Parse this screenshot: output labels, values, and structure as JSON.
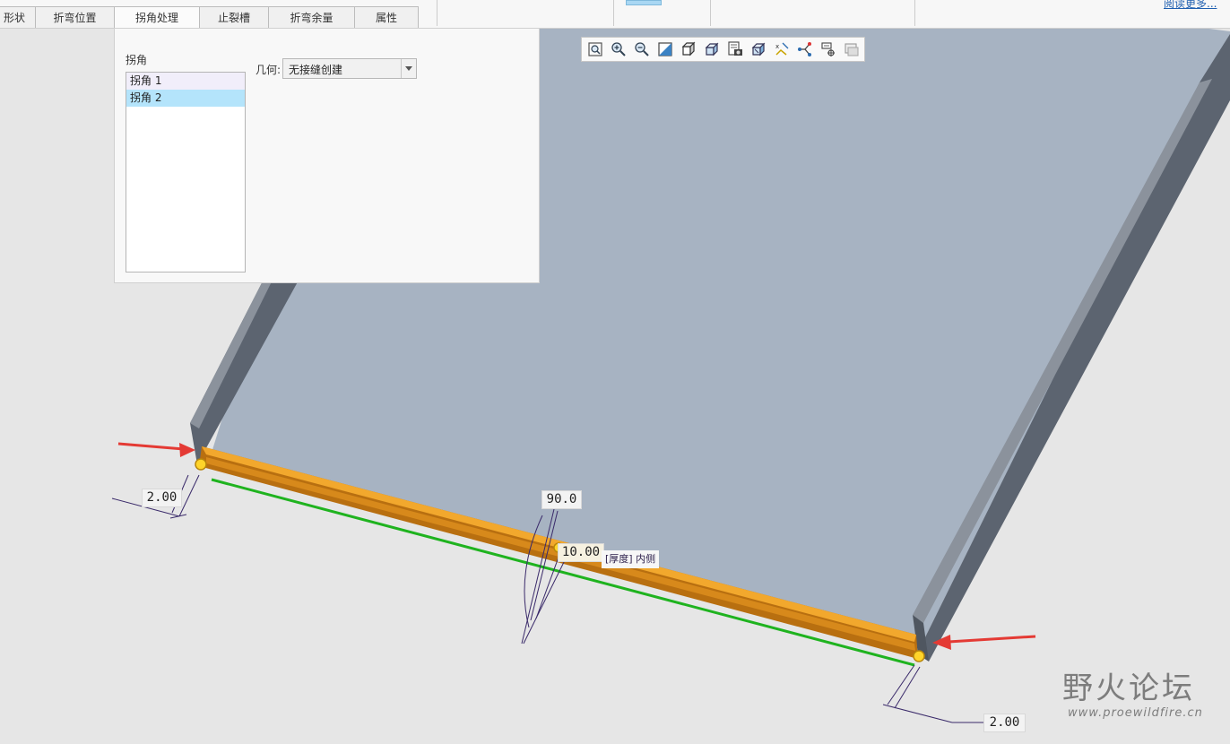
{
  "tabs": [
    {
      "label": "形状"
    },
    {
      "label": "折弯位置"
    },
    {
      "label": "拐角处理"
    },
    {
      "label": "止裂槽"
    },
    {
      "label": "折弯余量"
    },
    {
      "label": "属性"
    }
  ],
  "active_tab": "拐角处理",
  "read_more": "阅读更多...",
  "panel": {
    "corner_label": "拐角",
    "corners": [
      "拐角 1",
      "拐角 2"
    ],
    "selected_corner": "拐角 2",
    "geometry_label": "几何:",
    "geometry_value": "无接缝创建"
  },
  "view_toolbar": {
    "icons": [
      "refit-icon",
      "zoom-in-icon",
      "zoom-out-icon",
      "repaint-icon",
      "display-style-icon",
      "view-orientation-icon",
      "saved-views-icon",
      "view-manager-icon",
      "datum-display-icon",
      "annotation-display-icon",
      "spin-center-icon",
      "plane-display-icon"
    ]
  },
  "model": {
    "dim_left": "2.00",
    "dim_right": "2.00",
    "angle": "90.0",
    "length": "10.00",
    "side_label": "[厚度] 内侧"
  },
  "watermark": {
    "title": "野火论坛",
    "url": "www.proewildfire.cn"
  },
  "colors": {
    "plate": "#a7b3c2",
    "wall_side": "#5c6470",
    "wall_top": "#8c939d",
    "flange": "#f0a42a",
    "flange_dark": "#b86f10",
    "edge_green": "#1fb31f",
    "callout_red": "#e43a34",
    "dimension": "#3a2a6a"
  }
}
